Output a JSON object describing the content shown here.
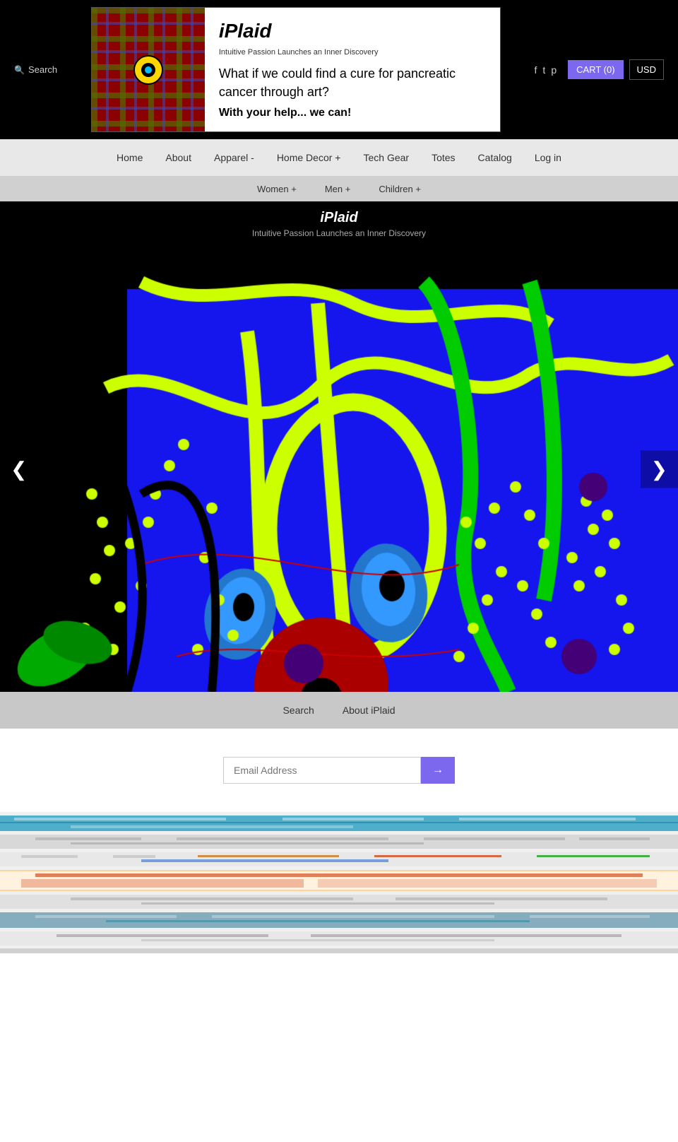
{
  "header": {
    "search_label": "Search",
    "logo": {
      "brand": "iPlaid",
      "tagline_small": "Intuitive Passion Launches an Inner Discovery",
      "tagline_big": "What if we could find a cure for pancreatic cancer through art?",
      "tagline_sub": "With your help... we can!"
    },
    "social": [
      "f",
      "t",
      "p"
    ],
    "cart": {
      "label": "CART",
      "count": "(0)"
    },
    "currency": "USD"
  },
  "nav": {
    "primary": [
      {
        "label": "Home",
        "id": "home"
      },
      {
        "label": "About",
        "id": "about"
      },
      {
        "label": "Apparel",
        "id": "apparel",
        "dropdown": true,
        "symbol": "-"
      },
      {
        "label": "Home Decor",
        "id": "home-decor",
        "dropdown": true,
        "symbol": "+"
      },
      {
        "label": "Tech Gear",
        "id": "tech-gear"
      },
      {
        "label": "Totes",
        "id": "totes"
      },
      {
        "label": "Catalog",
        "id": "catalog"
      },
      {
        "label": "Log in",
        "id": "login"
      }
    ],
    "secondary": [
      {
        "label": "Women +",
        "id": "women"
      },
      {
        "label": "Men +",
        "id": "men"
      },
      {
        "label": "Children +",
        "id": "children"
      }
    ]
  },
  "brand_bar": {
    "name": "iPlaid",
    "subtitle": "Intuitive Passion Launches an Inner Discovery"
  },
  "slideshow": {
    "prev_label": "❮",
    "next_label": "❯"
  },
  "footer_nav": [
    {
      "label": "Search",
      "id": "footer-search"
    },
    {
      "label": "About iPlaid",
      "id": "footer-about"
    }
  ],
  "email_section": {
    "placeholder": "Email Address",
    "submit_label": "→"
  },
  "colors": {
    "accent": "#7B68EE",
    "cart_bg": "#7B68EE",
    "nav_bg": "#e8e8e8",
    "subnav_bg": "#d0d0d0",
    "header_bg": "#000000",
    "brand_bar_bg": "#000000"
  }
}
